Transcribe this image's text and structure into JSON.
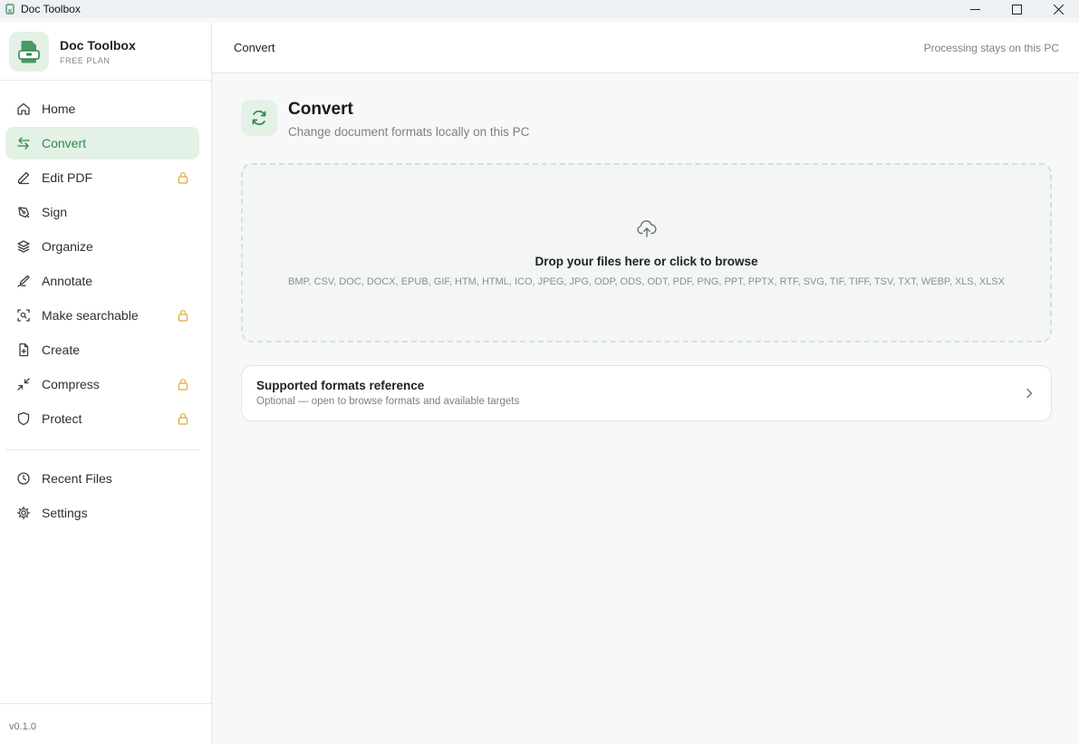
{
  "window": {
    "title": "Doc Toolbox",
    "icon": "app-logo-icon",
    "controls": [
      "minimize-icon",
      "maximize-icon",
      "close-icon"
    ]
  },
  "brand": {
    "name": "Doc Toolbox",
    "plan": "FREE PLAN",
    "icon": "toolbox-logo-icon"
  },
  "nav": {
    "items": [
      {
        "label": "Home",
        "icon": "home-icon",
        "locked": false,
        "active": false
      },
      {
        "label": "Convert",
        "icon": "convert-arrows-icon",
        "locked": false,
        "active": true
      },
      {
        "label": "Edit PDF",
        "icon": "pen-icon",
        "locked": true,
        "active": false
      },
      {
        "label": "Sign",
        "icon": "signature-icon",
        "locked": false,
        "active": false
      },
      {
        "label": "Organize",
        "icon": "layers-icon",
        "locked": false,
        "active": false
      },
      {
        "label": "Annotate",
        "icon": "annotate-icon",
        "locked": false,
        "active": false
      },
      {
        "label": "Make searchable",
        "icon": "scan-icon",
        "locked": true,
        "active": false
      },
      {
        "label": "Create",
        "icon": "file-plus-icon",
        "locked": false,
        "active": false
      },
      {
        "label": "Compress",
        "icon": "compress-icon",
        "locked": true,
        "active": false
      },
      {
        "label": "Protect",
        "icon": "shield-icon",
        "locked": true,
        "active": false
      }
    ],
    "secondary": [
      {
        "label": "Recent Files",
        "icon": "clock-icon"
      },
      {
        "label": "Settings",
        "icon": "gear-icon"
      }
    ]
  },
  "footer": {
    "version": "v0.1.0"
  },
  "topbar": {
    "breadcrumb": "Convert",
    "note": "Processing stays on this PC"
  },
  "page": {
    "title": "Convert",
    "subtitle": "Change document formats locally on this PC",
    "icon": "refresh-icon"
  },
  "dropzone": {
    "icon": "cloud-upload-icon",
    "title": "Drop your files here or click to browse",
    "formats": "BMP, CSV, DOC, DOCX, EPUB, GIF, HTM, HTML, ICO, JPEG, JPG, ODP, ODS, ODT, PDF, PNG, PPT, PPTX, RTF, SVG, TIF, TIFF, TSV, TXT, WEBP, XLS, XLSX"
  },
  "formats_card": {
    "title": "Supported formats reference",
    "subtitle": "Optional — open to browse formats and available targets",
    "icon": "chevron-right-icon"
  },
  "colors": {
    "accent": "#2f8a4c",
    "accent_bg": "#e3f1e6",
    "lock": "#e3a73a",
    "sidebar_bg": "#ffffff",
    "main_bg": "#f7f8f7"
  }
}
